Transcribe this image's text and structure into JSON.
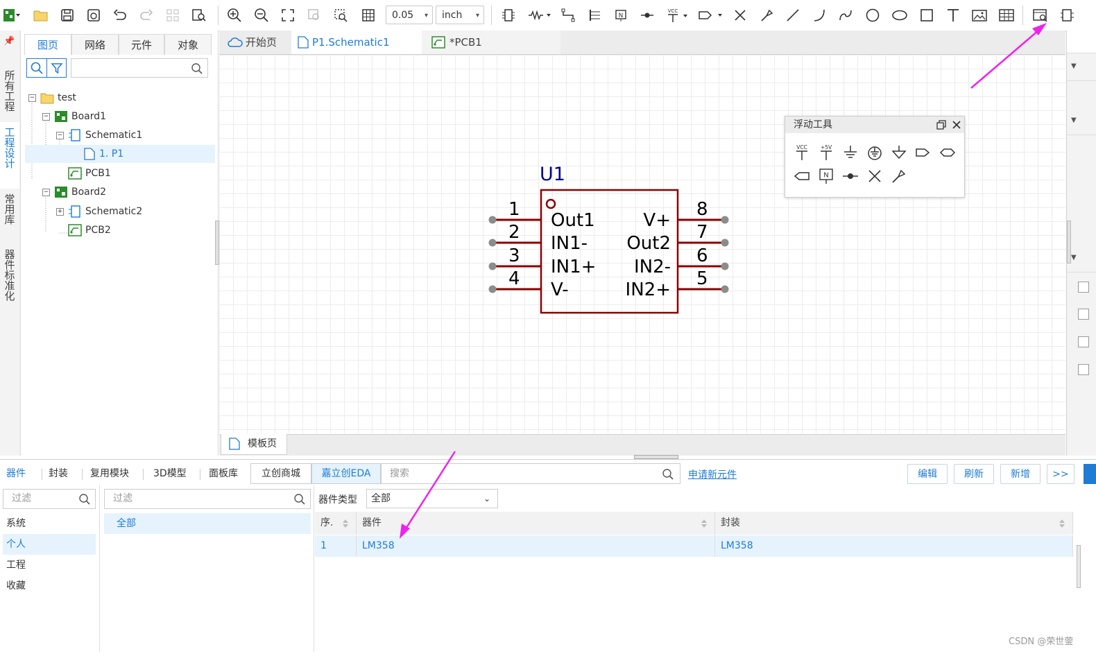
{
  "toolbar": {
    "grid_value": "0.05",
    "unit": "inch"
  },
  "left_vertical_tabs": [
    {
      "label": "所有工程"
    },
    {
      "label": "工程设计"
    },
    {
      "label": "常用库"
    },
    {
      "label": "器件标准化"
    }
  ],
  "left_panel": {
    "tabs": [
      "图页",
      "网络",
      "元件",
      "对象"
    ],
    "search_placeholder": "",
    "tree": [
      {
        "label": "test"
      },
      {
        "label": "Board1"
      },
      {
        "label": "Schematic1"
      },
      {
        "label": "1. P1"
      },
      {
        "label": "PCB1"
      },
      {
        "label": "Board2"
      },
      {
        "label": "Schematic2"
      },
      {
        "label": "PCB2"
      }
    ]
  },
  "doc_tabs": [
    {
      "label": "开始页"
    },
    {
      "label": "P1.Schematic1"
    },
    {
      "label": "*PCB1"
    }
  ],
  "schematic": {
    "designator": "U1",
    "left_pins": [
      {
        "number": "1",
        "name": "Out1"
      },
      {
        "number": "2",
        "name": "IN1-"
      },
      {
        "number": "3",
        "name": "IN1+"
      },
      {
        "number": "4",
        "name": "V-"
      }
    ],
    "right_pins": [
      {
        "number": "8",
        "name": "V+"
      },
      {
        "number": "7",
        "name": "Out2"
      },
      {
        "number": "6",
        "name": "IN2-"
      },
      {
        "number": "5",
        "name": "IN2+"
      }
    ]
  },
  "floating_tools": {
    "title": "浮动工具",
    "vcc_label": "VCC",
    "p5v_label": "+5V",
    "netlabel_letter": "N"
  },
  "canvas_footer_tab": {
    "label": "模板页"
  },
  "bottom": {
    "tabs": [
      "器件",
      "封装",
      "复用模块",
      "3D模型",
      "面板库",
      "立创商城",
      "嘉立创EDA"
    ],
    "search_placeholder": "搜索",
    "apply_link": "申请新元件",
    "buttons": {
      "edit": "编辑",
      "refresh": "刷新",
      "add": "新增",
      "more": ">>"
    },
    "filter_placeholder": "过滤",
    "filter2_placeholder": "过滤",
    "categories": [
      "系统",
      "个人",
      "工程",
      "收藏"
    ],
    "subcategory": "全部",
    "type_label": "器件类型",
    "type_value": "全部",
    "table": {
      "columns": [
        "序.",
        "器件",
        "封装"
      ],
      "rows": [
        {
          "index": "1",
          "device": "LM358",
          "footprint": "LM358"
        }
      ]
    }
  },
  "watermark": "CSDN @荣世蓥",
  "colors": {
    "accent": "#1e7bd6",
    "schematic": "#8b0000",
    "pin_dot": "#8c8c8c",
    "designator": "#00008b",
    "arrow": "#ee22ee"
  }
}
